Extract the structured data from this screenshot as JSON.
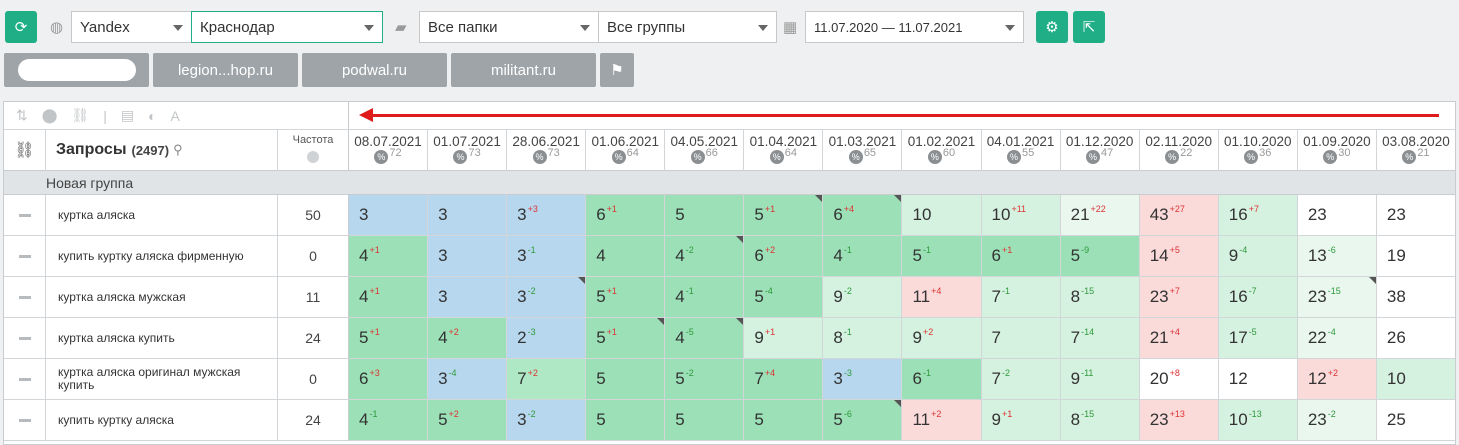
{
  "toolbar": {
    "refresh_icon": "refresh-icon",
    "engine": "Yandex",
    "region": "Краснодар",
    "folders": "Все папки",
    "groups": "Все группы",
    "date_range": "11.07.2020 — 11.07.2021",
    "settings_icon": "gear-icon",
    "export_icon": "export-icon"
  },
  "site_tabs": [
    "",
    "legion...hop.ru",
    "podwal.ru",
    "militant.ru"
  ],
  "table": {
    "header": {
      "queries_label": "Запросы",
      "queries_count": "(2497)",
      "freq_label": "Частота"
    },
    "dates": [
      {
        "date": "08.07.2021",
        "pct": "72"
      },
      {
        "date": "01.07.2021",
        "pct": "73"
      },
      {
        "date": "28.06.2021",
        "pct": "73"
      },
      {
        "date": "01.06.2021",
        "pct": "64"
      },
      {
        "date": "04.05.2021",
        "pct": "66"
      },
      {
        "date": "01.04.2021",
        "pct": "64"
      },
      {
        "date": "01.03.2021",
        "pct": "65"
      },
      {
        "date": "01.02.2021",
        "pct": "60"
      },
      {
        "date": "04.01.2021",
        "pct": "55"
      },
      {
        "date": "01.12.2020",
        "pct": "47"
      },
      {
        "date": "02.11.2020",
        "pct": "22"
      },
      {
        "date": "01.10.2020",
        "pct": "36"
      },
      {
        "date": "01.09.2020",
        "pct": "30"
      },
      {
        "date": "03.08.2020",
        "pct": "21"
      }
    ],
    "group_name": "Новая группа",
    "rows": [
      {
        "query": "куртка аляска",
        "freq": "50",
        "cells": [
          [
            "3",
            "",
            "b",
            0
          ],
          [
            "3",
            "",
            "b",
            0
          ],
          [
            "3",
            "+3",
            "b",
            0
          ],
          [
            "6",
            "+1",
            "g",
            0
          ],
          [
            "5",
            "",
            "g",
            0
          ],
          [
            "5",
            "+1",
            "g",
            1
          ],
          [
            "6",
            "+4",
            "g",
            1
          ],
          [
            "10",
            "",
            "l",
            0
          ],
          [
            "10",
            "+11",
            "l",
            0
          ],
          [
            "21",
            "+22",
            "vl",
            0
          ],
          [
            "43",
            "+27",
            "r",
            0
          ],
          [
            "16",
            "+7",
            "l",
            0
          ],
          [
            "23",
            "",
            "w",
            0
          ],
          [
            "23",
            "",
            "w",
            0
          ]
        ]
      },
      {
        "query": "купить куртку аляска фирменную",
        "freq": "0",
        "cells": [
          [
            "4",
            "+1",
            "g",
            0
          ],
          [
            "3",
            "",
            "b",
            0
          ],
          [
            "3",
            "-1",
            "b",
            0
          ],
          [
            "4",
            "",
            "g",
            0
          ],
          [
            "4",
            "-2",
            "g",
            1
          ],
          [
            "6",
            "+2",
            "g",
            0
          ],
          [
            "4",
            "-1",
            "g",
            0
          ],
          [
            "5",
            "-1",
            "g",
            0
          ],
          [
            "6",
            "+1",
            "g",
            0
          ],
          [
            "5",
            "-9",
            "g",
            0
          ],
          [
            "14",
            "+5",
            "r",
            0
          ],
          [
            "9",
            "-4",
            "l",
            0
          ],
          [
            "13",
            "-6",
            "vl",
            0
          ],
          [
            "19",
            "",
            "w",
            0
          ]
        ]
      },
      {
        "query": "куртка аляска мужская",
        "freq": "11",
        "cells": [
          [
            "4",
            "+1",
            "g",
            0
          ],
          [
            "3",
            "",
            "b",
            0
          ],
          [
            "3",
            "-2",
            "b",
            1
          ],
          [
            "5",
            "+1",
            "g",
            0
          ],
          [
            "4",
            "-1",
            "g",
            0
          ],
          [
            "5",
            "-4",
            "g",
            0
          ],
          [
            "9",
            "-2",
            "l",
            0
          ],
          [
            "11",
            "+4",
            "r",
            0
          ],
          [
            "7",
            "-1",
            "l",
            0
          ],
          [
            "8",
            "-15",
            "l",
            0
          ],
          [
            "23",
            "+7",
            "r",
            0
          ],
          [
            "16",
            "-7",
            "l",
            0
          ],
          [
            "23",
            "-15",
            "vl",
            1
          ],
          [
            "38",
            "",
            "w",
            0
          ]
        ]
      },
      {
        "query": "куртка аляска купить",
        "freq": "24",
        "cells": [
          [
            "5",
            "+1",
            "g",
            0
          ],
          [
            "4",
            "+2",
            "g",
            0
          ],
          [
            "2",
            "-3",
            "b",
            0
          ],
          [
            "5",
            "+1",
            "g",
            1
          ],
          [
            "4",
            "-5",
            "g",
            1
          ],
          [
            "9",
            "+1",
            "l",
            0
          ],
          [
            "8",
            "-1",
            "l",
            0
          ],
          [
            "9",
            "+2",
            "l",
            0
          ],
          [
            "7",
            "",
            "l",
            0
          ],
          [
            "7",
            "-14",
            "l",
            0
          ],
          [
            "21",
            "+4",
            "r",
            0
          ],
          [
            "17",
            "-5",
            "l",
            0
          ],
          [
            "22",
            "-4",
            "vl",
            0
          ],
          [
            "26",
            "",
            "w",
            0
          ]
        ]
      },
      {
        "query": "куртка аляска оригинал мужская купить",
        "freq": "0",
        "cells": [
          [
            "6",
            "+3",
            "g",
            0
          ],
          [
            "3",
            "-4",
            "b",
            0
          ],
          [
            "7",
            "+2",
            "g2",
            0
          ],
          [
            "5",
            "",
            "g",
            0
          ],
          [
            "5",
            "-2",
            "g",
            0
          ],
          [
            "7",
            "+4",
            "g",
            0
          ],
          [
            "3",
            "-3",
            "b",
            0
          ],
          [
            "6",
            "-1",
            "g",
            0
          ],
          [
            "7",
            "-2",
            "l",
            0
          ],
          [
            "9",
            "-11",
            "l",
            0
          ],
          [
            "20",
            "+8",
            "w",
            0
          ],
          [
            "12",
            "",
            "w",
            0
          ],
          [
            "12",
            "+2",
            "r",
            0
          ],
          [
            "10",
            "",
            "l",
            0
          ]
        ]
      },
      {
        "query": "купить куртку аляска",
        "freq": "24",
        "cells": [
          [
            "4",
            "-1",
            "g",
            0
          ],
          [
            "5",
            "+2",
            "g",
            0
          ],
          [
            "3",
            "-2",
            "b",
            0
          ],
          [
            "5",
            "",
            "g",
            0
          ],
          [
            "5",
            "",
            "g",
            0
          ],
          [
            "5",
            "",
            "g",
            0
          ],
          [
            "5",
            "-6",
            "g",
            1
          ],
          [
            "11",
            "+2",
            "r",
            0
          ],
          [
            "9",
            "+1",
            "l",
            0
          ],
          [
            "8",
            "-15",
            "l",
            0
          ],
          [
            "23",
            "+13",
            "r",
            0
          ],
          [
            "10",
            "-13",
            "l",
            0
          ],
          [
            "23",
            "-2",
            "vl",
            0
          ],
          [
            "25",
            "",
            "w",
            0
          ]
        ]
      }
    ]
  }
}
